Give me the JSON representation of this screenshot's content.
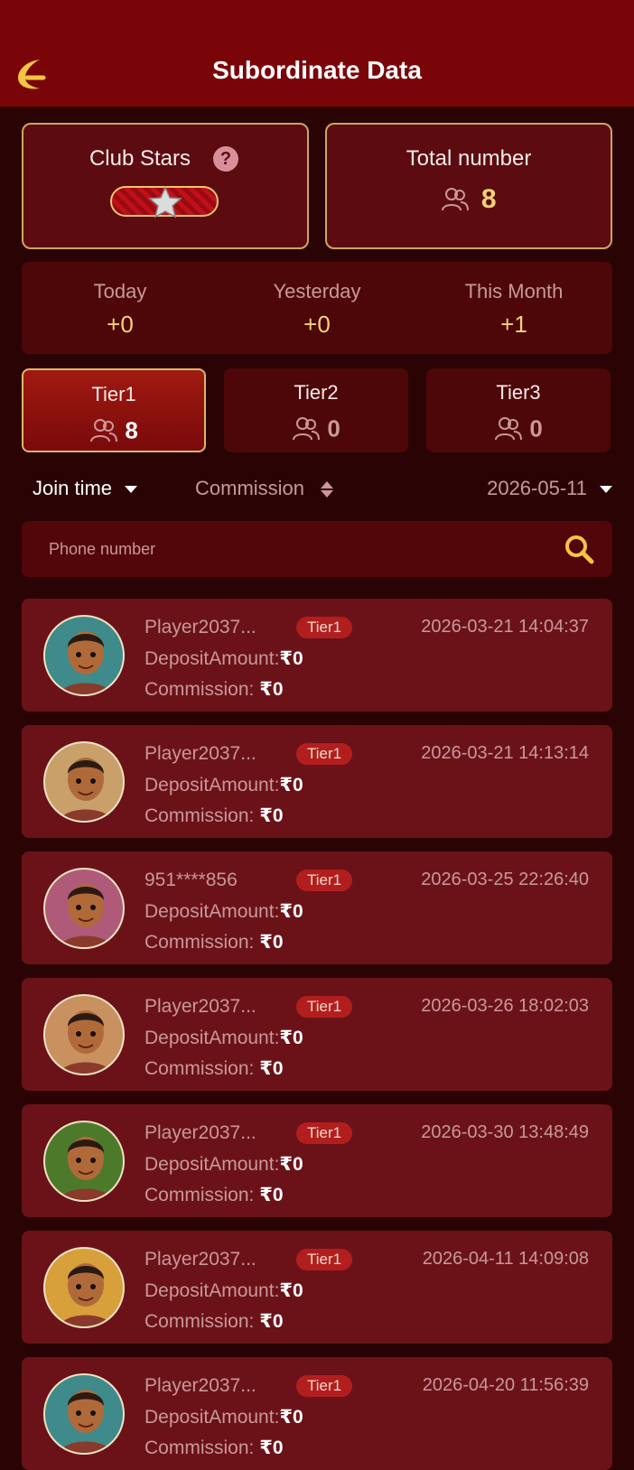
{
  "header": {
    "title": "Subordinate Data",
    "back_icon": "back-arrow-icon"
  },
  "club_stars": {
    "label": "Club Stars",
    "help": "?",
    "stars": 1
  },
  "total": {
    "label": "Total number",
    "value": "8"
  },
  "stats": [
    {
      "label": "Today",
      "value": "+0"
    },
    {
      "label": "Yesterday",
      "value": "+0"
    },
    {
      "label": "This Month",
      "value": "+1"
    }
  ],
  "tiers": [
    {
      "label": "Tier1",
      "count": "8",
      "active": true
    },
    {
      "label": "Tier2",
      "count": "0",
      "active": false
    },
    {
      "label": "Tier3",
      "count": "0",
      "active": false
    }
  ],
  "filters": {
    "join_time": "Join time",
    "commission": "Commission",
    "date": "2026-05-11"
  },
  "search": {
    "placeholder": "Phone number"
  },
  "deposit_label": "DepositAmount:",
  "commission_label": "Commission:",
  "colors": {
    "accent": "#f3d27a",
    "header": "#7a0508",
    "card": "#6b1219"
  },
  "rows": [
    {
      "name": "Player2037...",
      "tier": "Tier1",
      "date": "2026-03-21 14:04:37",
      "deposit": "₹0",
      "commission": "₹0"
    },
    {
      "name": "Player2037...",
      "tier": "Tier1",
      "date": "2026-03-21 14:13:14",
      "deposit": "₹0",
      "commission": "₹0"
    },
    {
      "name": "951****856",
      "tier": "Tier1",
      "date": "2026-03-25 22:26:40",
      "deposit": "₹0",
      "commission": "₹0"
    },
    {
      "name": "Player2037...",
      "tier": "Tier1",
      "date": "2026-03-26 18:02:03",
      "deposit": "₹0",
      "commission": "₹0"
    },
    {
      "name": "Player2037...",
      "tier": "Tier1",
      "date": "2026-03-30 13:48:49",
      "deposit": "₹0",
      "commission": "₹0"
    },
    {
      "name": "Player2037...",
      "tier": "Tier1",
      "date": "2026-04-11 14:09:08",
      "deposit": "₹0",
      "commission": "₹0"
    },
    {
      "name": "Player2037...",
      "tier": "Tier1",
      "date": "2026-04-20 11:56:39",
      "deposit": "₹0",
      "commission": "₹0"
    }
  ]
}
